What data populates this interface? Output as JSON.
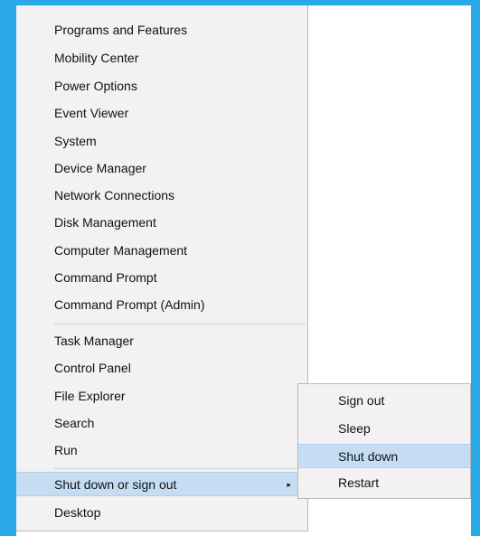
{
  "menu": {
    "items": [
      {
        "label": "Programs and Features"
      },
      {
        "label": "Mobility Center"
      },
      {
        "label": "Power Options"
      },
      {
        "label": "Event Viewer"
      },
      {
        "label": "System"
      },
      {
        "label": "Device Manager"
      },
      {
        "label": "Network Connections"
      },
      {
        "label": "Disk Management"
      },
      {
        "label": "Computer Management"
      },
      {
        "label": "Command Prompt"
      },
      {
        "label": "Command Prompt (Admin)"
      },
      {
        "label": "Task Manager"
      },
      {
        "label": "Control Panel"
      },
      {
        "label": "File Explorer"
      },
      {
        "label": "Search"
      },
      {
        "label": "Run"
      },
      {
        "label": "Shut down or sign out",
        "submenu_arrow": "▸"
      },
      {
        "label": "Desktop"
      }
    ]
  },
  "submenu": {
    "items": [
      {
        "label": "Sign out"
      },
      {
        "label": "Sleep"
      },
      {
        "label": "Shut down"
      },
      {
        "label": "Restart"
      }
    ]
  },
  "colors": {
    "frame_accent": "#29a9e8",
    "highlight": "#c5ddf3",
    "menu_bg": "#f2f2f2"
  }
}
